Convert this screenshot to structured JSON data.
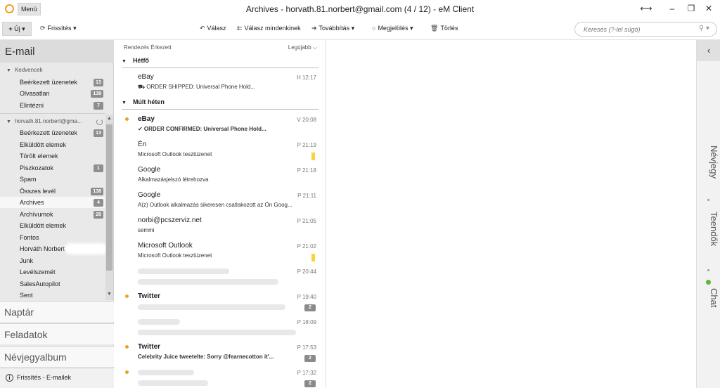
{
  "window": {
    "title": "Archives - horvath.81.norbert@gmail.com (4 / 12) - eM Client",
    "menu_label": "Menü"
  },
  "toolbar": {
    "new_label": "Új",
    "refresh_label": "Frissítés",
    "reply_label": "Válasz",
    "reply_all_label": "Válasz mindenkinek",
    "forward_label": "Továbbítás",
    "mark_label": "Megjelölés",
    "delete_label": "Törlés",
    "search_placeholder": "Keresés (?-lel súgó)"
  },
  "sidebar": {
    "title": "E-mail",
    "favorites": {
      "label": "Kedvencek",
      "items": [
        {
          "label": "Beérkezett üzenetek",
          "badge": "13"
        },
        {
          "label": "Olvasatlan",
          "badge": "138"
        },
        {
          "label": "Elintézni",
          "badge": "7"
        }
      ]
    },
    "account": {
      "label": "horvath.81.norbert@gma...",
      "items": [
        {
          "label": "Beérkezett üzenetek",
          "badge": "13"
        },
        {
          "label": "Elküldött elemek",
          "badge": ""
        },
        {
          "label": "Törölt elemek",
          "badge": ""
        },
        {
          "label": "Piszkozatok",
          "badge": "1"
        },
        {
          "label": "Spam",
          "badge": ""
        },
        {
          "label": "Összes levél",
          "badge": "138"
        },
        {
          "label": "Archives",
          "badge": "4"
        },
        {
          "label": "Archívumok",
          "badge": "28"
        },
        {
          "label": "Elküldött elemek",
          "badge": ""
        },
        {
          "label": "Fontos",
          "badge": ""
        },
        {
          "label": "Horváth Norbert",
          "badge": ""
        },
        {
          "label": "Junk",
          "badge": ""
        },
        {
          "label": "Levélszemét",
          "badge": ""
        },
        {
          "label": "SalesAutopilot",
          "badge": ""
        },
        {
          "label": "Sent",
          "badge": ""
        }
      ]
    },
    "sections": [
      "Naptár",
      "Feladatok",
      "Névjegyalbum"
    ],
    "status": "Frissítés - E-mailek"
  },
  "message_list": {
    "sort_label": "Rendezés Érkezett",
    "sort_order": "Legújabb",
    "groups": [
      {
        "label": "Hétfő",
        "messages": [
          {
            "from": "eBay",
            "subject": "⛟ ORDER SHIPPED: Universal Phone Hold...",
            "time": "H 12:17",
            "unread": false,
            "flag": false,
            "count": ""
          }
        ]
      },
      {
        "label": "Múlt héten",
        "messages": [
          {
            "from": "eBay",
            "subject": "✔ ORDER CONFIRMED: Universal Phone Hold...",
            "time": "V 20:08",
            "unread": true,
            "flag": false,
            "count": ""
          },
          {
            "from": "Én",
            "subject": "Microsoft Outlook tesztüzenet",
            "time": "P 21:19",
            "unread": false,
            "flag": true,
            "count": ""
          },
          {
            "from": "Google",
            "subject": "Alkalmazásjelszó létrehozva",
            "time": "P 21:18",
            "unread": false,
            "flag": false,
            "count": ""
          },
          {
            "from": "Google",
            "subject": "A(z) Outlook alkalmazás sikeresen csatlakozott az Ön Goog...",
            "time": "P 21:11",
            "unread": false,
            "flag": false,
            "count": ""
          },
          {
            "from": "norbi@pcszerviz.net",
            "subject": "semmi",
            "time": "P 21:05",
            "unread": false,
            "flag": false,
            "count": ""
          },
          {
            "from": "Microsoft Outlook",
            "subject": "Microsoft Outlook tesztüzenet",
            "time": "P 21:02",
            "unread": false,
            "flag": true,
            "count": ""
          },
          {
            "from": "",
            "subject": "",
            "time": "P 20:44",
            "unread": false,
            "flag": false,
            "count": ""
          },
          {
            "from": "Twitter",
            "subject": "",
            "time": "P 19:40",
            "unread": true,
            "flag": false,
            "count": "2"
          },
          {
            "from": "",
            "subject": "",
            "time": "P 18:09",
            "unread": false,
            "flag": false,
            "count": ""
          },
          {
            "from": "Twitter",
            "subject": "Celebrity Juice tweetelte: Sorry @fearnecotton it'...",
            "time": "P 17:53",
            "unread": true,
            "flag": false,
            "count": "2"
          },
          {
            "from": "",
            "subject": "",
            "time": "P 17:32",
            "unread": true,
            "flag": false,
            "count": "2"
          }
        ]
      }
    ]
  },
  "right_panel": {
    "labels": [
      "Névjegy",
      "Teendők",
      "Chat"
    ]
  },
  "colors": {
    "unread_dot": "#f0a020",
    "flag": "#f5d53a",
    "badge": "#8e8e8e",
    "chat_online": "#5cb82e"
  }
}
